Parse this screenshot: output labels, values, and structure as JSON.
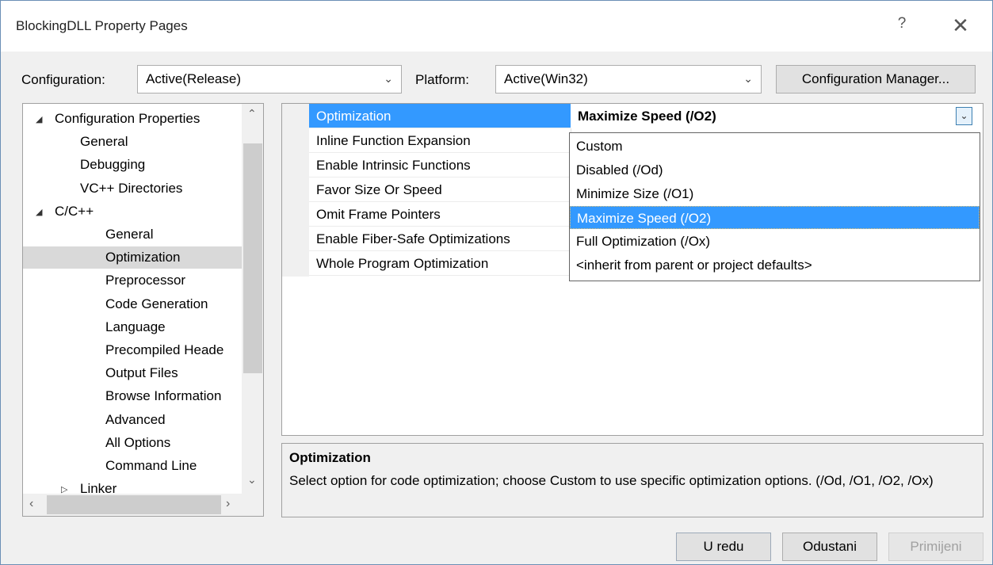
{
  "window": {
    "title": "BlockingDLL Property Pages",
    "help": "?",
    "close": "✕"
  },
  "toolbar": {
    "configuration_label": "Configuration:",
    "configuration_value": "Active(Release)",
    "platform_label": "Platform:",
    "platform_value": "Active(Win32)",
    "config_manager": "Configuration Manager..."
  },
  "tree": {
    "items": [
      {
        "label": "Configuration Properties",
        "expanded": true
      },
      {
        "label": "General"
      },
      {
        "label": "Debugging"
      },
      {
        "label": "VC++ Directories"
      },
      {
        "label": "C/C++",
        "expanded": true
      },
      {
        "label": "General"
      },
      {
        "label": "Optimization",
        "selected": true
      },
      {
        "label": "Preprocessor"
      },
      {
        "label": "Code Generation"
      },
      {
        "label": "Language"
      },
      {
        "label": "Precompiled Heade"
      },
      {
        "label": "Output Files"
      },
      {
        "label": "Browse Information"
      },
      {
        "label": "Advanced"
      },
      {
        "label": "All Options"
      },
      {
        "label": "Command Line"
      },
      {
        "label": "Linker",
        "expanded": false
      }
    ]
  },
  "properties": {
    "rows": [
      {
        "name": "Optimization"
      },
      {
        "name": "Inline Function Expansion"
      },
      {
        "name": "Enable Intrinsic Functions"
      },
      {
        "name": "Favor Size Or Speed"
      },
      {
        "name": "Omit Frame Pointers"
      },
      {
        "name": "Enable Fiber-Safe Optimizations"
      },
      {
        "name": "Whole Program Optimization"
      }
    ],
    "selected_value": "Maximize Speed (/O2)"
  },
  "dropdown": {
    "options": [
      "Custom",
      "Disabled (/Od)",
      "Minimize Size (/O1)",
      "Maximize Speed (/O2)",
      "Full Optimization (/Ox)",
      "<inherit from parent or project defaults>"
    ],
    "selected": "Maximize Speed (/O2)"
  },
  "description": {
    "title": "Optimization",
    "body": "Select option for code optimization; choose Custom to use specific optimization options.     (/Od, /O1, /O2, /Ox)"
  },
  "buttons": {
    "ok": "U redu",
    "cancel": "Odustani",
    "apply": "Primijeni"
  },
  "colors": {
    "selection": "#3399ff",
    "window_bg": "#f0f0f0"
  }
}
